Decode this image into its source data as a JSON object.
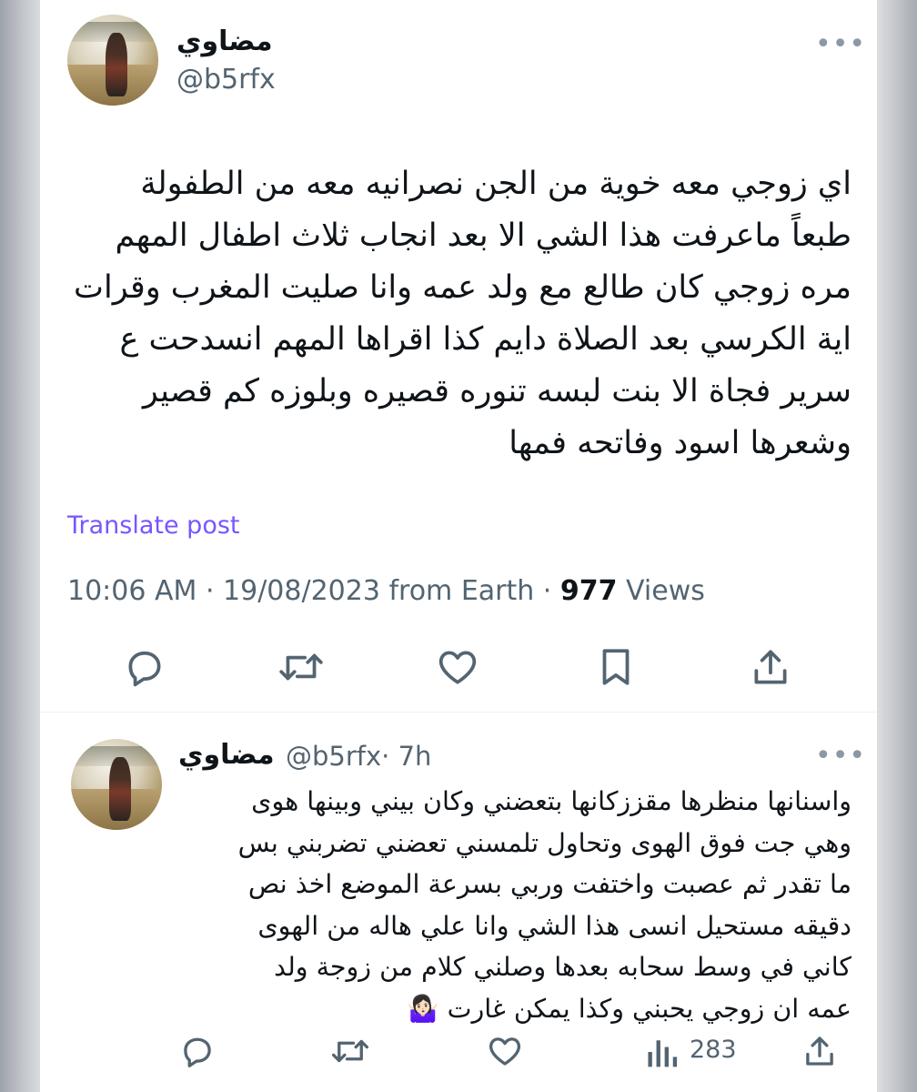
{
  "main_post": {
    "author_name": "مضاوي",
    "handle": "@b5rfx",
    "more_label": "•••",
    "lines": [
      "اي زوجي معه خوية من الجن نصرانيه معه من الطفولة",
      "طبعاً ماعرفت هذا الشي الا بعد انجاب ثلاث اطفال المهم",
      "مره زوجي كان طالع مع ولد عمه وانا صليت المغرب وقرات",
      "اية الكرسي بعد الصلاة دايم كذا اقراها المهم انسدحت ع",
      "سرير فجاة الا بنت لبسه تنوره قصيره وبلوزه كم قصير",
      "وشعرها اسود وفاتحه فمها"
    ],
    "translate_label": "Translate post",
    "time": "10:06 AM",
    "separator1": " · ",
    "date_source": "19/08/2023 from Earth",
    "separator2": " · ",
    "views_count": "977",
    "views_label": " Views"
  },
  "reply_post": {
    "author_name": "مضاوي",
    "handle": "@b5rfx",
    "age": "· 7h",
    "more_label": "•••",
    "lines": [
      "واسنانها منظرها مقززكانها بتعضني وكان بيني وبينها هوى",
      "وهي جت فوق الهوى وتحاول تلمسني تعضني تضربني بس",
      "ما تقدر ثم عصبت واختفت وربي بسرعة الموضع اخذ نص",
      "دقيقه مستحيل انسى هذا الشي وانا علي هاله من الهوى",
      "كاني في وسط سحابه بعدها وصلني كلام من زوجة ولد",
      "عمه ان زوجي يحبني وكذا يمكن غارت 🤷🏻‍♀️"
    ],
    "views_count": "283"
  },
  "icons": {
    "reply": "reply-icon",
    "repost": "repost-icon",
    "like": "like-icon",
    "bookmark": "bookmark-icon",
    "share": "share-icon",
    "views": "views-icon"
  },
  "colors": {
    "link": "#7856ff",
    "muted": "#536471",
    "text": "#0f1419"
  }
}
